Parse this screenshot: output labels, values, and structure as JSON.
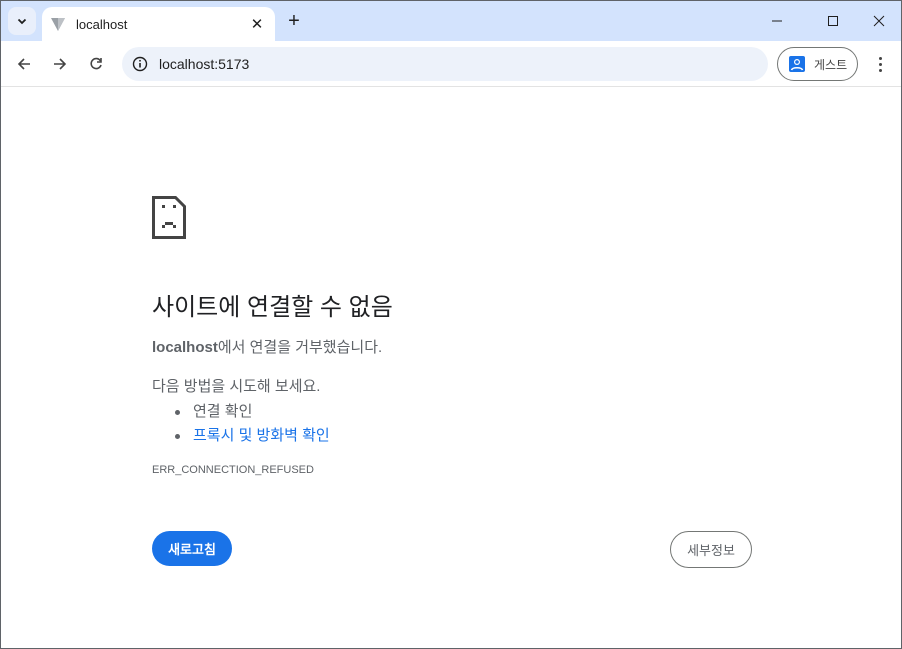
{
  "tab": {
    "title": "localhost"
  },
  "omnibox": {
    "url": "localhost:5173"
  },
  "profile": {
    "label": "게스트"
  },
  "error": {
    "title": "사이트에 연결할 수 없음",
    "host": "localhost",
    "message": "에서 연결을 거부했습니다.",
    "try_label": "다음 방법을 시도해 보세요.",
    "suggestions": [
      "연결 확인",
      "프록시 및 방화벽 확인"
    ],
    "code": "ERR_CONNECTION_REFUSED"
  },
  "buttons": {
    "reload": "새로고침",
    "details": "세부정보"
  },
  "colors": {
    "accent": "#1a73e8",
    "tabstrip": "#d3e3fd"
  }
}
